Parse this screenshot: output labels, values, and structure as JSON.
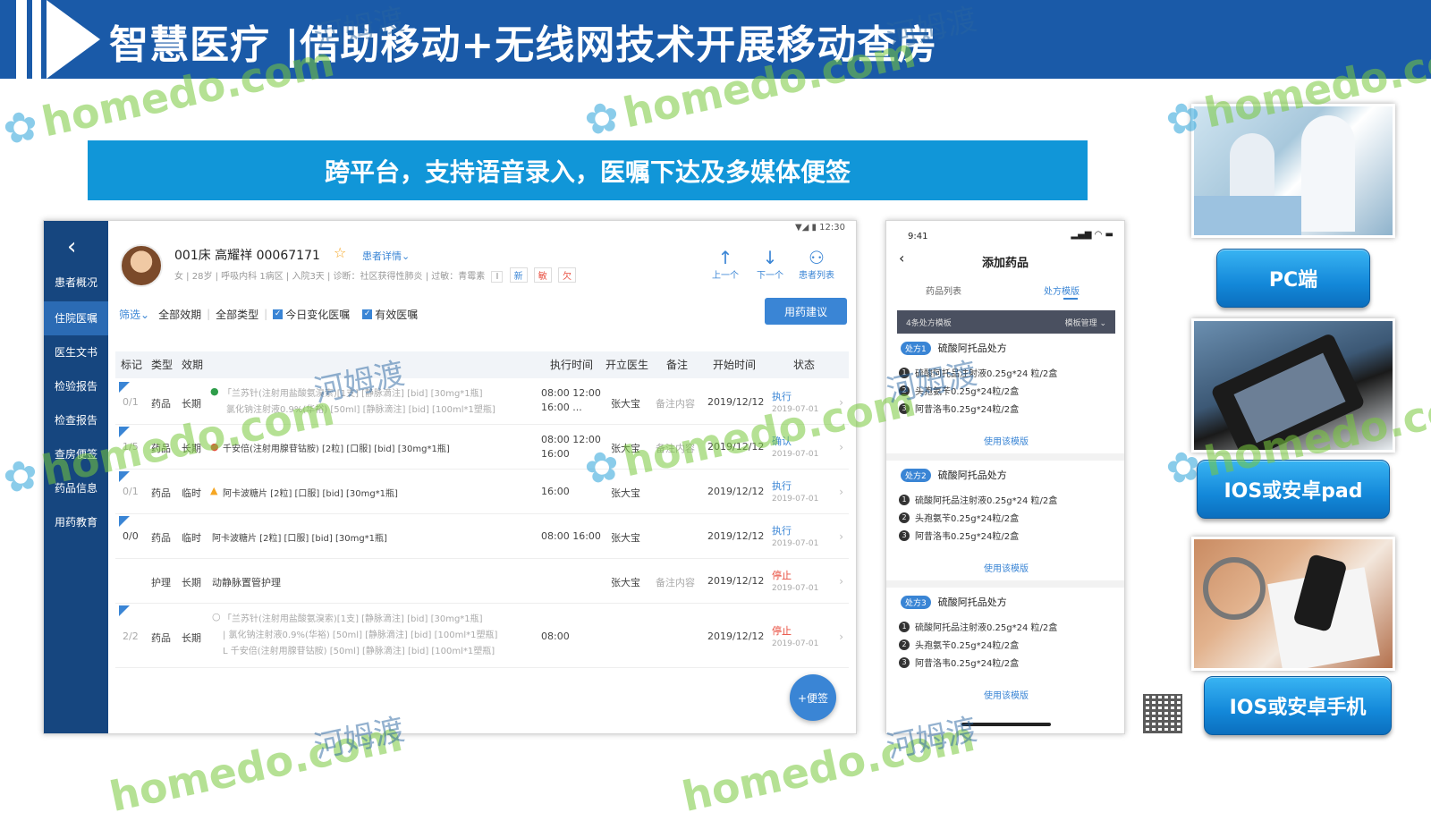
{
  "header": {
    "title": "智慧医疗 |借助移动+无线网技术开展移动查房"
  },
  "banner": {
    "text": "跨平台，支持语音录入，医嘱下达及多媒体便签"
  },
  "tablet": {
    "status_bar": "▼◢ ▮ 12:30",
    "sidebar": {
      "back": "‹",
      "items": [
        {
          "label": "患者概况"
        },
        {
          "label": "住院医嘱"
        },
        {
          "label": "医生文书"
        },
        {
          "label": "检验报告"
        },
        {
          "label": "检查报告"
        },
        {
          "label": "查房便签"
        },
        {
          "label": "药品信息"
        },
        {
          "label": "用药教育"
        }
      ]
    },
    "patient": {
      "name_line": "001床  高耀祥  00067171",
      "star": "☆",
      "detail_link": "患者详情⌄",
      "info_line": "女 | 28岁 | 呼吸内科 1病区 | 入院3天 | 诊断：社区获得性肺炎 | 过敏：青霉素",
      "tags": [
        "I",
        "新",
        "敏",
        "欠"
      ]
    },
    "nav": {
      "prev": "上一个",
      "next": "下一个",
      "list": "患者列表"
    },
    "filter": {
      "filter_label": "筛选⌄",
      "all_period": "全部效期",
      "all_type": "全部类型",
      "today_change": "今日变化医嘱",
      "valid": "有效医嘱",
      "advise_button": "用药建议"
    },
    "table": {
      "headers": [
        "标记",
        "类型",
        "效期",
        "执行时间",
        "开立医生",
        "备注",
        "开始时间",
        "状态"
      ],
      "rows": [
        {
          "mark": "0/1",
          "type": "药品",
          "period": "长期",
          "content": [
            "「兰苏针(注射用盐酸氨溴索)[1支] [静脉滴注] [bid] [30mg*1瓶]",
            "氯化钠注射液0.9%(华裕) [50ml] [静脉滴注] [bid] [100ml*1塑瓶]"
          ],
          "exec_time": [
            "08:00 12:00",
            "16:00 ..."
          ],
          "doctor": "张大宝",
          "note": "备注内容",
          "start": "2019/12/12",
          "status": "执行",
          "status_date": "2019-07-01"
        },
        {
          "mark": "1/5",
          "type": "药品",
          "period": "长期",
          "content": [
            "千安倍(注射用腺苷钴胺) [2粒] [口服] [bid] [30mg*1瓶]"
          ],
          "exec_time": [
            "08:00 12:00",
            "16:00"
          ],
          "doctor": "张大宝",
          "note": "备注内容",
          "start": "2019/12/12",
          "status": "确认",
          "status_date": "2019-07-01"
        },
        {
          "mark": "0/1",
          "type": "药品",
          "period": "临时",
          "content": [
            "阿卡波糖片 [2粒] [口服] [bid] [30mg*1瓶]"
          ],
          "exec_time": [
            "16:00"
          ],
          "doctor": "张大宝",
          "note": "",
          "start": "2019/12/12",
          "status": "执行",
          "status_date": "2019-07-01"
        },
        {
          "mark": "0/0",
          "type": "药品",
          "period": "临时",
          "content": [
            "阿卡波糖片 [2粒] [口服] [bid] [30mg*1瓶]"
          ],
          "exec_time": [
            "08:00 16:00"
          ],
          "doctor": "张大宝",
          "note": "",
          "start": "2019/12/12",
          "status": "执行",
          "status_date": "2019-07-01"
        },
        {
          "mark": "",
          "type": "护理",
          "period": "长期",
          "content": [
            "动静脉置管护理"
          ],
          "exec_time": [
            ""
          ],
          "doctor": "张大宝",
          "note": "备注内容",
          "start": "2019/12/12",
          "status": "停止",
          "status_date": "2019-07-01"
        },
        {
          "mark": "2/2",
          "type": "药品",
          "period": "长期",
          "content": [
            "「兰苏针(注射用盐酸氨溴索)[1支] [静脉滴注] [bid] [30mg*1瓶]",
            "| 氯化钠注射液0.9%(华裕) [50ml] [静脉滴注] [bid] [100ml*1塑瓶]",
            "L 千安倍(注射用腺苷钴胺) [50ml] [静脉滴注] [bid] [100ml*1塑瓶]"
          ],
          "exec_time": [
            "08:00"
          ],
          "doctor": "",
          "note": "",
          "start": "2019/12/12",
          "status": "停止",
          "status_date": "2019-07-01"
        }
      ]
    },
    "fab": "+便签"
  },
  "phone": {
    "time": "9:41",
    "signal": "▂▄▆ ◠ ▬",
    "back": "‹",
    "title": "添加药品",
    "tabs": [
      "药品列表",
      "处方模版"
    ],
    "template_bar": {
      "left": "4条处方模板",
      "right": "模板管理 ⌄"
    },
    "prescriptions": [
      {
        "pill": "处方1",
        "name": "硫酸阿托品处方",
        "items": [
          "硫酸阿托品注射液0.25g*24 粒/2盒",
          "头孢氨苄0.25g*24粒/2盒",
          "阿昔洛韦0.25g*24粒/2盒"
        ],
        "use": "使用该模版"
      },
      {
        "pill": "处方2",
        "name": "硫酸阿托品处方",
        "items": [
          "硫酸阿托品注射液0.25g*24 粒/2盒",
          "头孢氨苄0.25g*24粒/2盒",
          "阿昔洛韦0.25g*24粒/2盒"
        ],
        "use": "使用该模版"
      },
      {
        "pill": "处方3",
        "name": "硫酸阿托品处方",
        "items": [
          "硫酸阿托品注射液0.25g*24 粒/2盒",
          "头孢氨苄0.25g*24粒/2盒",
          "阿昔洛韦0.25g*24粒/2盒"
        ],
        "use": "使用该模版"
      }
    ]
  },
  "right_column": {
    "pc_label": "PC端",
    "pad_label": "IOS或安卓pad",
    "phone_label": "IOS或安卓手机"
  },
  "watermarks": {
    "homedo": "homedo.com",
    "hemudu": "河姆渡"
  }
}
